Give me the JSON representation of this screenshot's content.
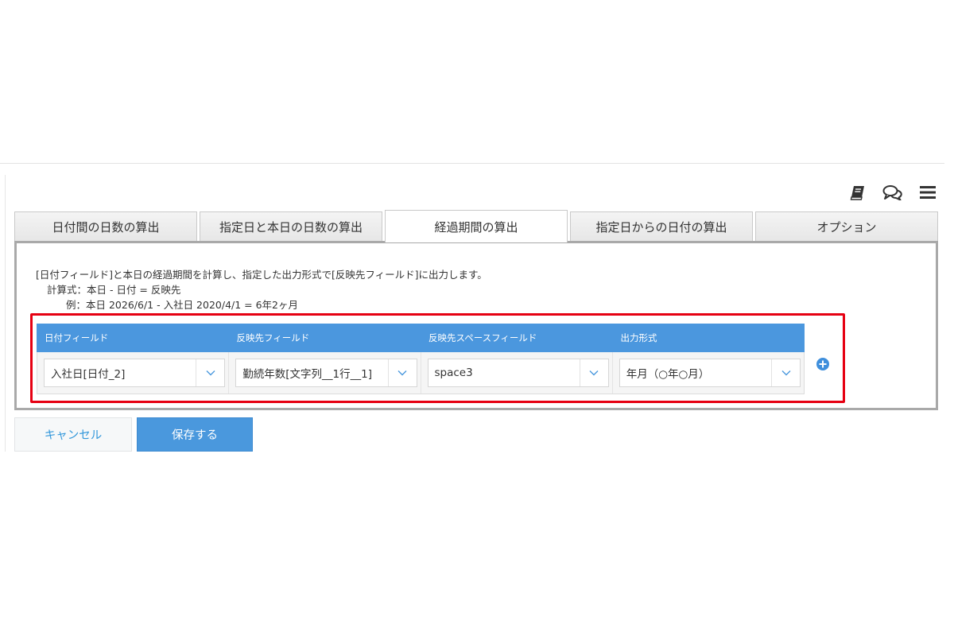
{
  "header": {
    "icons": [
      "book-icon",
      "comments-icon",
      "menu-icon"
    ]
  },
  "tabs": [
    {
      "label": "日付間の日数の算出",
      "active": false
    },
    {
      "label": "指定日と本日の日数の算出",
      "active": false
    },
    {
      "label": "経過期間の算出",
      "active": true
    },
    {
      "label": "指定日からの日付の算出",
      "active": false
    },
    {
      "label": "オプション",
      "active": false
    }
  ],
  "description": {
    "line1": "[日付フィールド]と本日の経過期間を計算し、指定した出力形式で[反映先フィールド]に出力します。",
    "line2": "計算式：本日 - 日付 = 反映先",
    "line3": "例：本日 2026/6/1 - 入社日 2020/4/1 = 6年2ヶ月"
  },
  "table": {
    "headers": [
      "日付フィールド",
      "反映先フィールド",
      "反映先スペースフィールド",
      "出力形式"
    ],
    "row": [
      "入社日[日付_2]",
      "勤続年数[文字列__1行__1]",
      "space3",
      "年月（○年○月）"
    ]
  },
  "buttons": {
    "cancel": "キャンセル",
    "save": "保存する"
  },
  "colors": {
    "accent": "#4a98dd",
    "highlight": "#e60012",
    "header_bg": "#4b97de"
  }
}
